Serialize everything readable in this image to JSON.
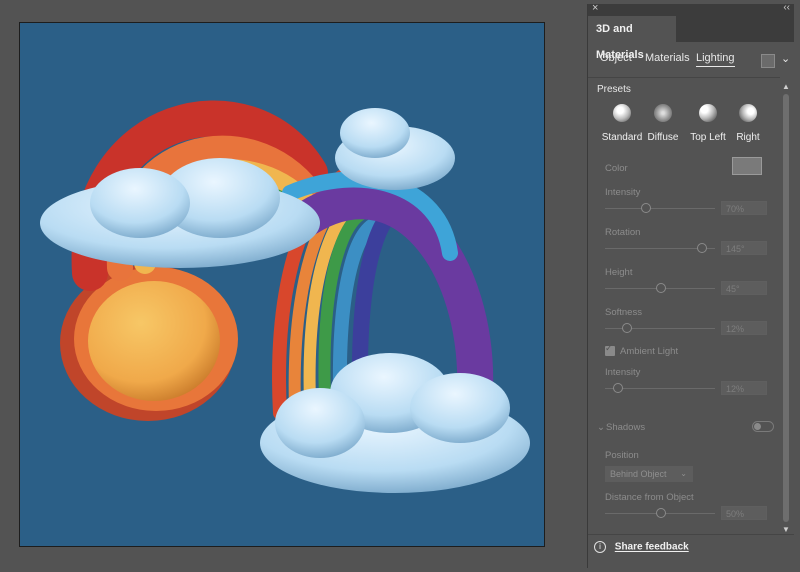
{
  "panel": {
    "title": "3D and Materials",
    "tabs": [
      "Object",
      "Materials",
      "Lighting"
    ],
    "active_tab": "Lighting",
    "presets_label": "Presets",
    "presets": [
      "Standard",
      "Diffuse",
      "Top Left",
      "Right"
    ],
    "color_label": "Color",
    "intensity_label": "Intensity",
    "intensity_value": "70%",
    "rotation_label": "Rotation",
    "rotation_value": "145°",
    "height_label": "Height",
    "height_value": "45°",
    "softness_label": "Softness",
    "softness_value": "12%",
    "ambient_label": "Ambient Light",
    "ambient_checked": true,
    "ambient_intensity_label": "Intensity",
    "ambient_intensity_value": "12%",
    "shadows_label": "Shadows",
    "position_label": "Position",
    "position_value": "Behind Object",
    "distance_label": "Distance from Object",
    "distance_value": "50%",
    "feedback": "Share feedback"
  },
  "colors": {
    "canvas_bg": "#2b5f87",
    "app_bg": "#535353",
    "panel_header": "#3c3c3c"
  },
  "icons": [
    "close-icon",
    "collapse-icon",
    "render-settings-icon",
    "chevron-down-icon",
    "info-icon",
    "scroll-up-icon",
    "scroll-down-icon"
  ]
}
